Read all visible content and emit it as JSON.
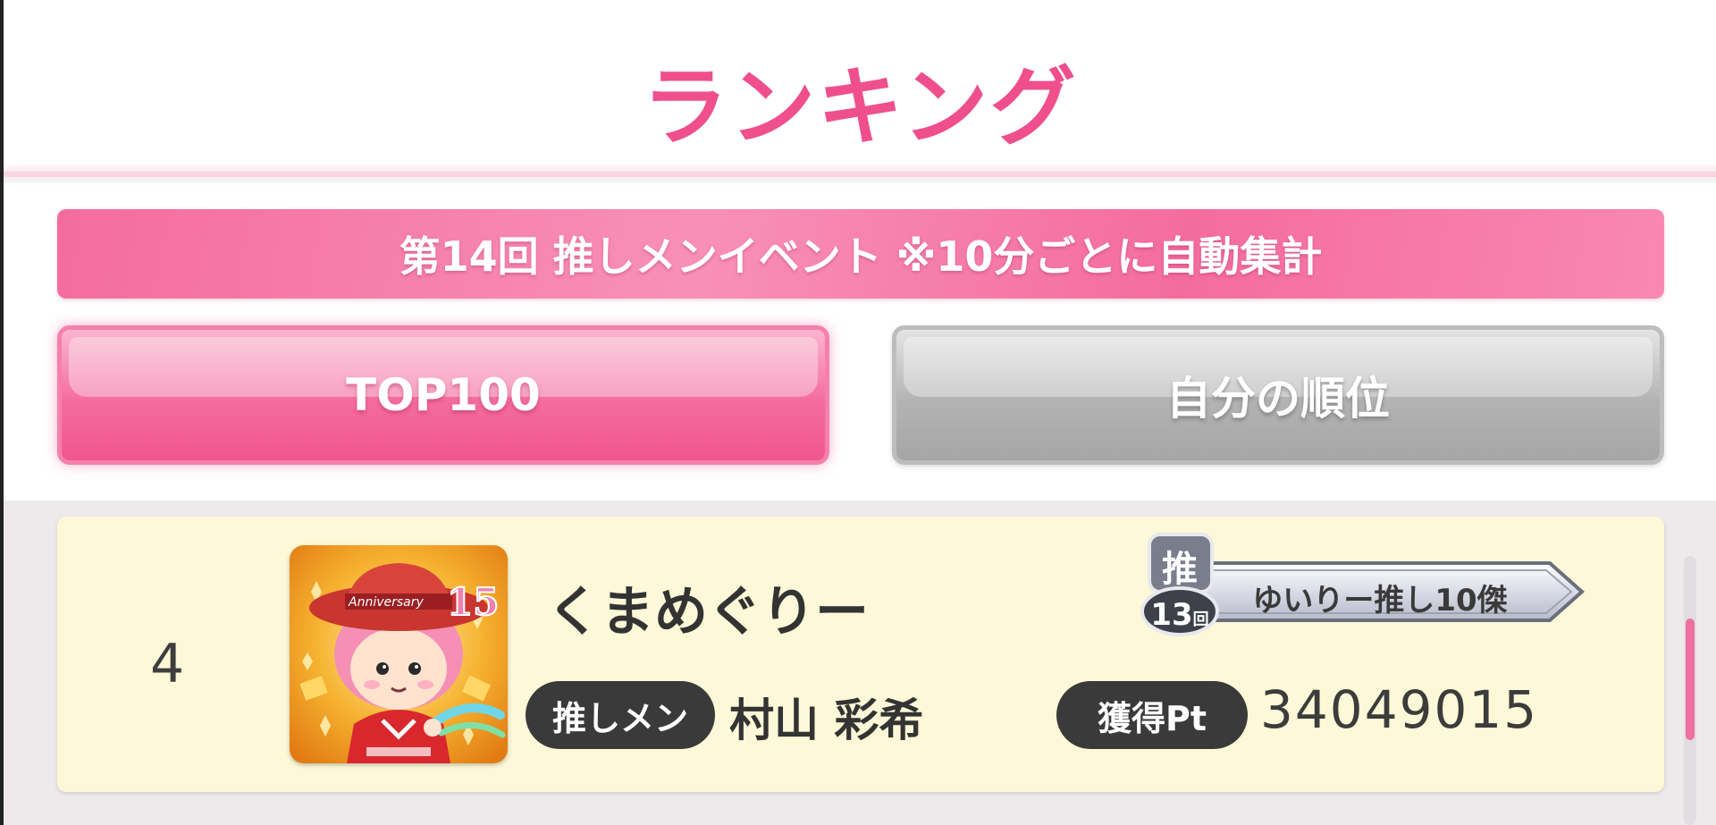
{
  "header": {
    "title": "ランキング"
  },
  "event_banner": {
    "text": "第14回 推しメンイベント ※10分ごとに自動集計"
  },
  "tabs": [
    {
      "label": "TOP100",
      "active": true
    },
    {
      "label": "自分の順位",
      "active": false
    }
  ],
  "ranking": {
    "entries": [
      {
        "rank": "4",
        "player_name": "くまめぐりー",
        "oshimen_label": "推しメン",
        "oshimen_name": "村山 彩希",
        "points_label": "獲得Pt",
        "points": "34049015",
        "title_badge": {
          "emblem_kanji": "推",
          "emblem_number": "13",
          "emblem_suffix": "回",
          "text": "ゆいりー推し10傑"
        },
        "avatar": {
          "description_icon": "anniversary-character-avatar",
          "hat_text": "Anniversary",
          "number_text": "15"
        }
      }
    ]
  },
  "colors": {
    "accent_pink": "#ef4f8d",
    "banner_pink": "#f46c9e",
    "row_background": "#fdf8d7",
    "pill_dark": "#3a3a3a"
  }
}
